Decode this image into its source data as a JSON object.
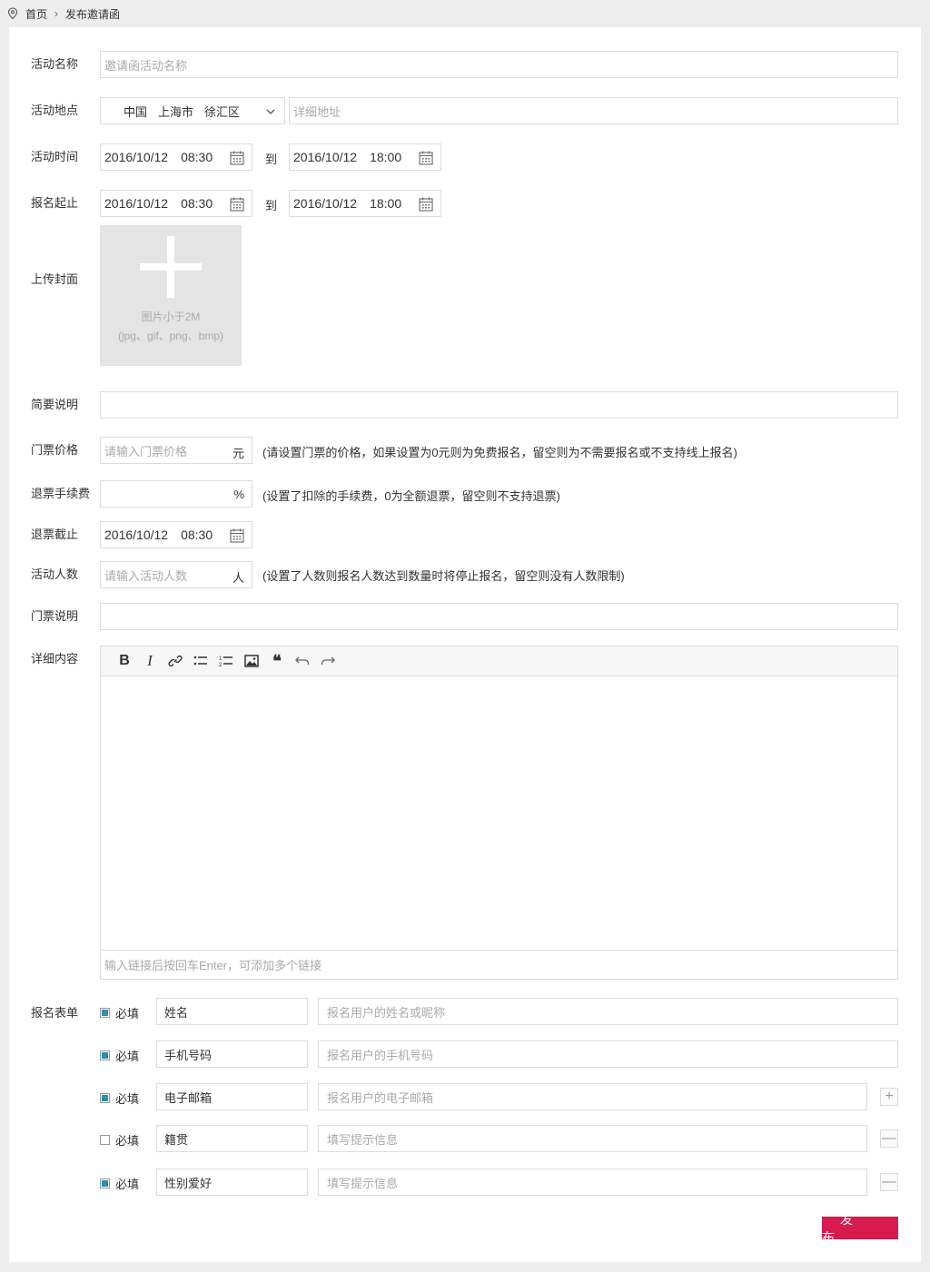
{
  "breadcrumb": {
    "home": "首页",
    "current": "发布邀请函"
  },
  "labels": {
    "name": "活动名称",
    "location": "活动地点",
    "time": "活动时间",
    "signup": "报名起止",
    "cover": "上传封面",
    "summary": "简要说明",
    "price": "门票价格",
    "refund_fee": "退票手续费",
    "refund_deadline": "退票截止",
    "headcount": "活动人数",
    "ticket_desc": "门票说明",
    "detail": "详细内容",
    "form": "报名表单"
  },
  "name_placeholder": "邀请函活动名称",
  "location": {
    "country": "中国",
    "city": "上海市",
    "district": "徐汇区",
    "address_placeholder": "详细地址"
  },
  "to": "到",
  "event_time": {
    "start_date": "2016/10/12",
    "start_time": "08:30",
    "end_date": "2016/10/12",
    "end_time": "18:00"
  },
  "signup_time": {
    "start_date": "2016/10/12",
    "start_time": "08:30",
    "end_date": "2016/10/12",
    "end_time": "18:00"
  },
  "cover": {
    "size_hint": "图片小于2M",
    "format_hint": "(jpg、gif、png、bmp)"
  },
  "price": {
    "placeholder": "请输入门票价格",
    "unit": "元",
    "hint": "(请设置门票的价格，如果设置为0元则为免费报名，留空则为不需要报名或不支持线上报名)"
  },
  "refund_fee": {
    "unit": "%",
    "hint": "(设置了扣除的手续费，0为全额退票，留空则不支持退票)"
  },
  "refund_deadline": {
    "date": "2016/10/12",
    "time": "08:30"
  },
  "headcount": {
    "placeholder": "请输入活动人数",
    "unit": "人",
    "hint": "(设置了人数则报名人数达到数量时将停止报名，留空则没有人数限制)"
  },
  "editor": {
    "tools": [
      "bold-icon",
      "italic-icon",
      "link-icon",
      "bullet-list-icon",
      "numbered-list-icon",
      "image-icon",
      "quote-icon",
      "undo-icon",
      "redo-icon"
    ],
    "link_placeholder": "输入链接后按回车Enter，可添加多个链接"
  },
  "form_fields": [
    {
      "required": true,
      "required_label": "必填",
      "name": "姓名",
      "hint": "报名用户的姓名或昵称",
      "action": ""
    },
    {
      "required": true,
      "required_label": "必填",
      "name": "手机号码",
      "hint": "报名用户的手机号码",
      "action": ""
    },
    {
      "required": true,
      "required_label": "必填",
      "name": "电子邮箱",
      "hint": "报名用户的电子邮箱",
      "action": "+"
    },
    {
      "required": false,
      "required_label": "必填",
      "name": "籍贯",
      "hint": "填写提示信息",
      "action": "—"
    },
    {
      "required": true,
      "required_label": "必填",
      "name": "性别爱好",
      "hint": "填写提示信息",
      "action": "—"
    }
  ],
  "publish_label": "发布",
  "colors": {
    "accent": "#d81b4e",
    "checkbox": "#2a8fb5",
    "border": "#dcdcdc"
  }
}
